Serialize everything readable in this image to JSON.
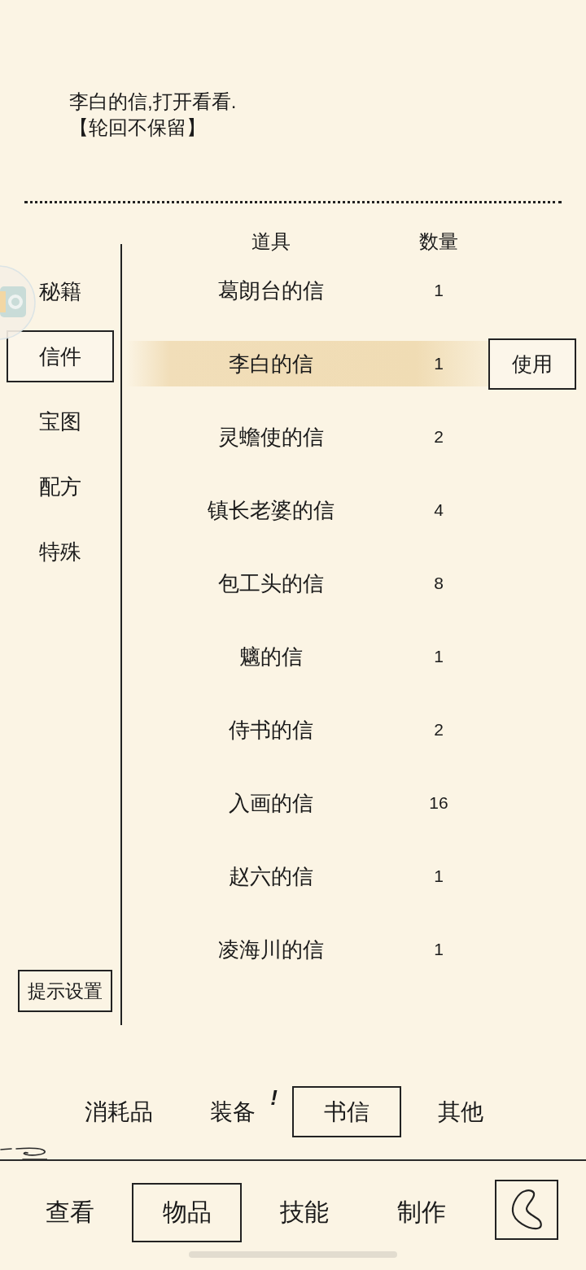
{
  "description": {
    "lines": [
      "李白的信,打开看看.",
      "【轮回不保留】"
    ]
  },
  "categories": [
    {
      "label": "秘籍",
      "selected": false
    },
    {
      "label": "信件",
      "selected": true
    },
    {
      "label": "宝图",
      "selected": false
    },
    {
      "label": "配方",
      "selected": false
    },
    {
      "label": "特殊",
      "selected": false
    }
  ],
  "hint_settings_button": "提示设置",
  "table": {
    "columns": [
      "道具",
      "数量"
    ],
    "action_button": "使用",
    "rows": [
      {
        "name": "葛朗台的信",
        "count": "1",
        "selected": false
      },
      {
        "name": "李白的信",
        "count": "1",
        "selected": true
      },
      {
        "name": "灵蟾使的信",
        "count": "2",
        "selected": false
      },
      {
        "name": "镇长老婆的信",
        "count": "4",
        "selected": false
      },
      {
        "name": "包工头的信",
        "count": "8",
        "selected": false
      },
      {
        "name": "魑的信",
        "count": "1",
        "selected": false
      },
      {
        "name": "侍书的信",
        "count": "2",
        "selected": false
      },
      {
        "name": "入画的信",
        "count": "16",
        "selected": false
      },
      {
        "name": "赵六的信",
        "count": "1",
        "selected": false
      },
      {
        "name": "凌海川的信",
        "count": "1",
        "selected": false
      }
    ]
  },
  "subtabs": [
    {
      "label": "消耗品",
      "selected": false
    },
    {
      "label": "装备",
      "selected": false,
      "alert": "!"
    },
    {
      "label": "书信",
      "selected": true
    },
    {
      "label": "其他",
      "selected": false
    }
  ],
  "nav_tabs": [
    {
      "label": "查看",
      "selected": false
    },
    {
      "label": "物品",
      "selected": true
    },
    {
      "label": "技能",
      "selected": false
    },
    {
      "label": "制作",
      "selected": false
    }
  ]
}
